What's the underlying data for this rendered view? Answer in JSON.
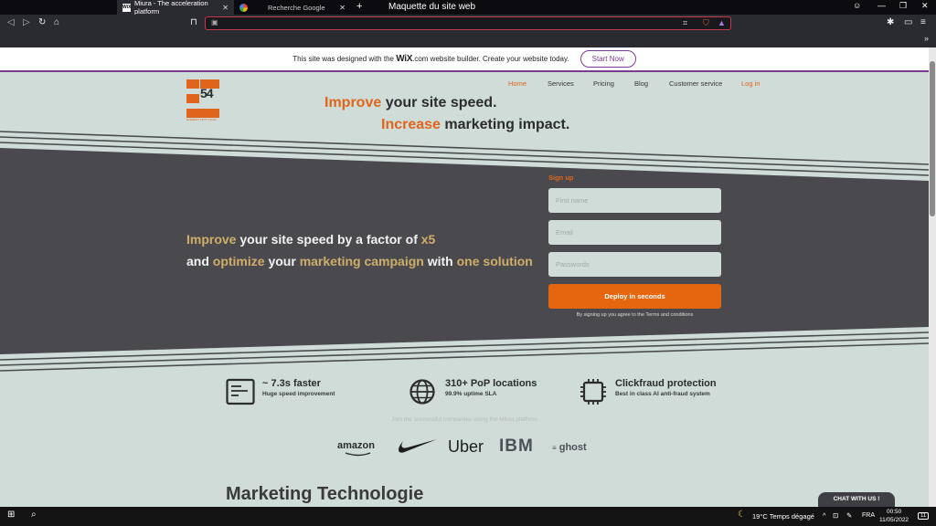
{
  "browser": {
    "tabs": [
      {
        "label": "Miura - The acceleration platform",
        "favicon": "WiX"
      },
      {
        "label": "Recherche Google",
        "favicon": "G"
      }
    ],
    "new_tab": "+",
    "window_title": "Maquette du site web",
    "bookmark_more": "»"
  },
  "wix_banner": {
    "text_before": "This site was designed with the",
    "brand": "WiX",
    "text_after": ".com website builder. Create your website today.",
    "button": "Start Now"
  },
  "site": {
    "logo_text": "54",
    "logo_caption": "ELEMENT FIFTY FOUR",
    "nav": [
      "Home",
      "Services",
      "Pricing",
      "Blog",
      "Customer service",
      "Log in"
    ],
    "headline1": {
      "accent": "Improve",
      "rest": " your site speed."
    },
    "headline2": {
      "accent": "Increase",
      "rest": " marketing impact."
    },
    "hero": {
      "l1_a": "Improve",
      "l1_b": " your site speed by a factor of ",
      "l1_c": "x5",
      "l2_a": "and ",
      "l2_b": "optimize",
      "l2_c": " your ",
      "l2_d": "marketing campaign",
      "l2_e": " with ",
      "l2_f": "one solution"
    },
    "signup": {
      "title": "Sign up",
      "first_name": "First name",
      "email": "Email",
      "password": "Passwords",
      "button": "Deploy in seconds",
      "terms": "By signing up you agree to the Terms and conditions"
    },
    "features": [
      {
        "title": "~ 7.3s faster",
        "subtitle": "Huge speed improvement",
        "icon": "terminal-icon"
      },
      {
        "title": "310+ PoP locations",
        "subtitle": "99.9% uptime SLA",
        "icon": "globe-icon"
      },
      {
        "title": "Clickfraud protection",
        "subtitle": "Best in class AI anti-fraud system",
        "icon": "chip-icon"
      }
    ],
    "join_text": "Join the successful companies using the Miura platform",
    "brands": [
      "amazon",
      "nike",
      "Uber",
      "IBM",
      "ghost"
    ],
    "section_title": "Marketing Technologie",
    "chat": "CHAT WITH US !"
  },
  "taskbar": {
    "weather": "19°C  Temps dégagé",
    "lang": "FRA",
    "time": "00:50",
    "date": "11/05/2022",
    "notif": "11"
  },
  "colors": {
    "accent": "#e0651c",
    "gold": "#cfad6a",
    "band": "#4a4a4e",
    "bg": "#cfdcd7"
  }
}
